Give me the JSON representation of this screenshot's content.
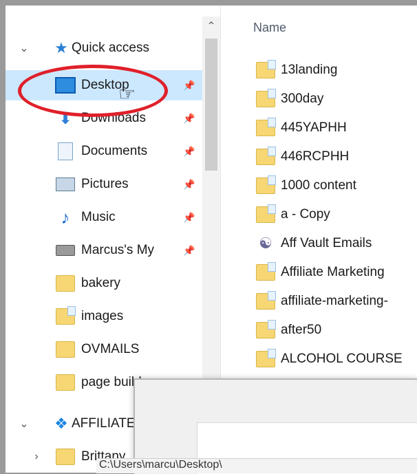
{
  "nav": {
    "quick_access": "Quick access",
    "items": [
      {
        "label": "Desktop",
        "icon": "desktop-icon"
      },
      {
        "label": "Downloads",
        "icon": "download-icon"
      },
      {
        "label": "Documents",
        "icon": "document-icon"
      },
      {
        "label": "Pictures",
        "icon": "pictures-icon"
      },
      {
        "label": "Music",
        "icon": "music-icon"
      },
      {
        "label": "Marcus's My",
        "icon": "drive-icon"
      },
      {
        "label": "bakery",
        "icon": "folder-icon"
      },
      {
        "label": "images",
        "icon": "folder-icon"
      },
      {
        "label": "OVMAILS",
        "icon": "folder-icon"
      },
      {
        "label": "page builders",
        "icon": "folder-icon"
      }
    ],
    "affiliate": "AFFILIATE",
    "brittany": "Brittany"
  },
  "content": {
    "column_name": "Name",
    "files": [
      "13landing",
      "300day",
      "445YAPHH",
      "446RCPHH",
      "1000 content",
      "a - Copy",
      "Aff Vault Emails",
      "Affiliate Marketing",
      "affiliate-marketing-",
      "after50",
      "ALCOHOL COURSE"
    ]
  },
  "dialog": {
    "path": "C:\\Users\\marcu\\Desktop\\"
  },
  "colors": {
    "selection": "#cce8ff",
    "highlight_ring": "#e0202a",
    "folder": "#f7d774"
  }
}
